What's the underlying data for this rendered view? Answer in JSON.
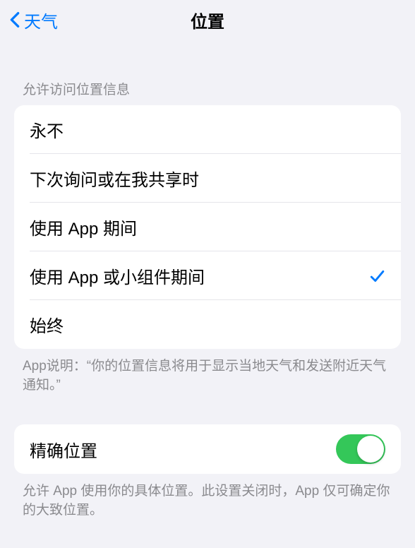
{
  "nav": {
    "back_label": "天气",
    "title": "位置"
  },
  "section1": {
    "header": "允许访问位置信息",
    "options": [
      {
        "label": "永不",
        "selected": false
      },
      {
        "label": "下次询问或在我共享时",
        "selected": false
      },
      {
        "label": "使用 App 期间",
        "selected": false
      },
      {
        "label": "使用 App 或小组件期间",
        "selected": true
      },
      {
        "label": "始终",
        "selected": false
      }
    ],
    "footer": "App说明：“你的位置信息将用于显示当地天气和发送附近天气通知。”"
  },
  "section2": {
    "precise_label": "精确位置",
    "precise_on": true,
    "footer": "允许 App 使用你的具体位置。此设置关闭时，App 仅可确定你的大致位置。"
  }
}
